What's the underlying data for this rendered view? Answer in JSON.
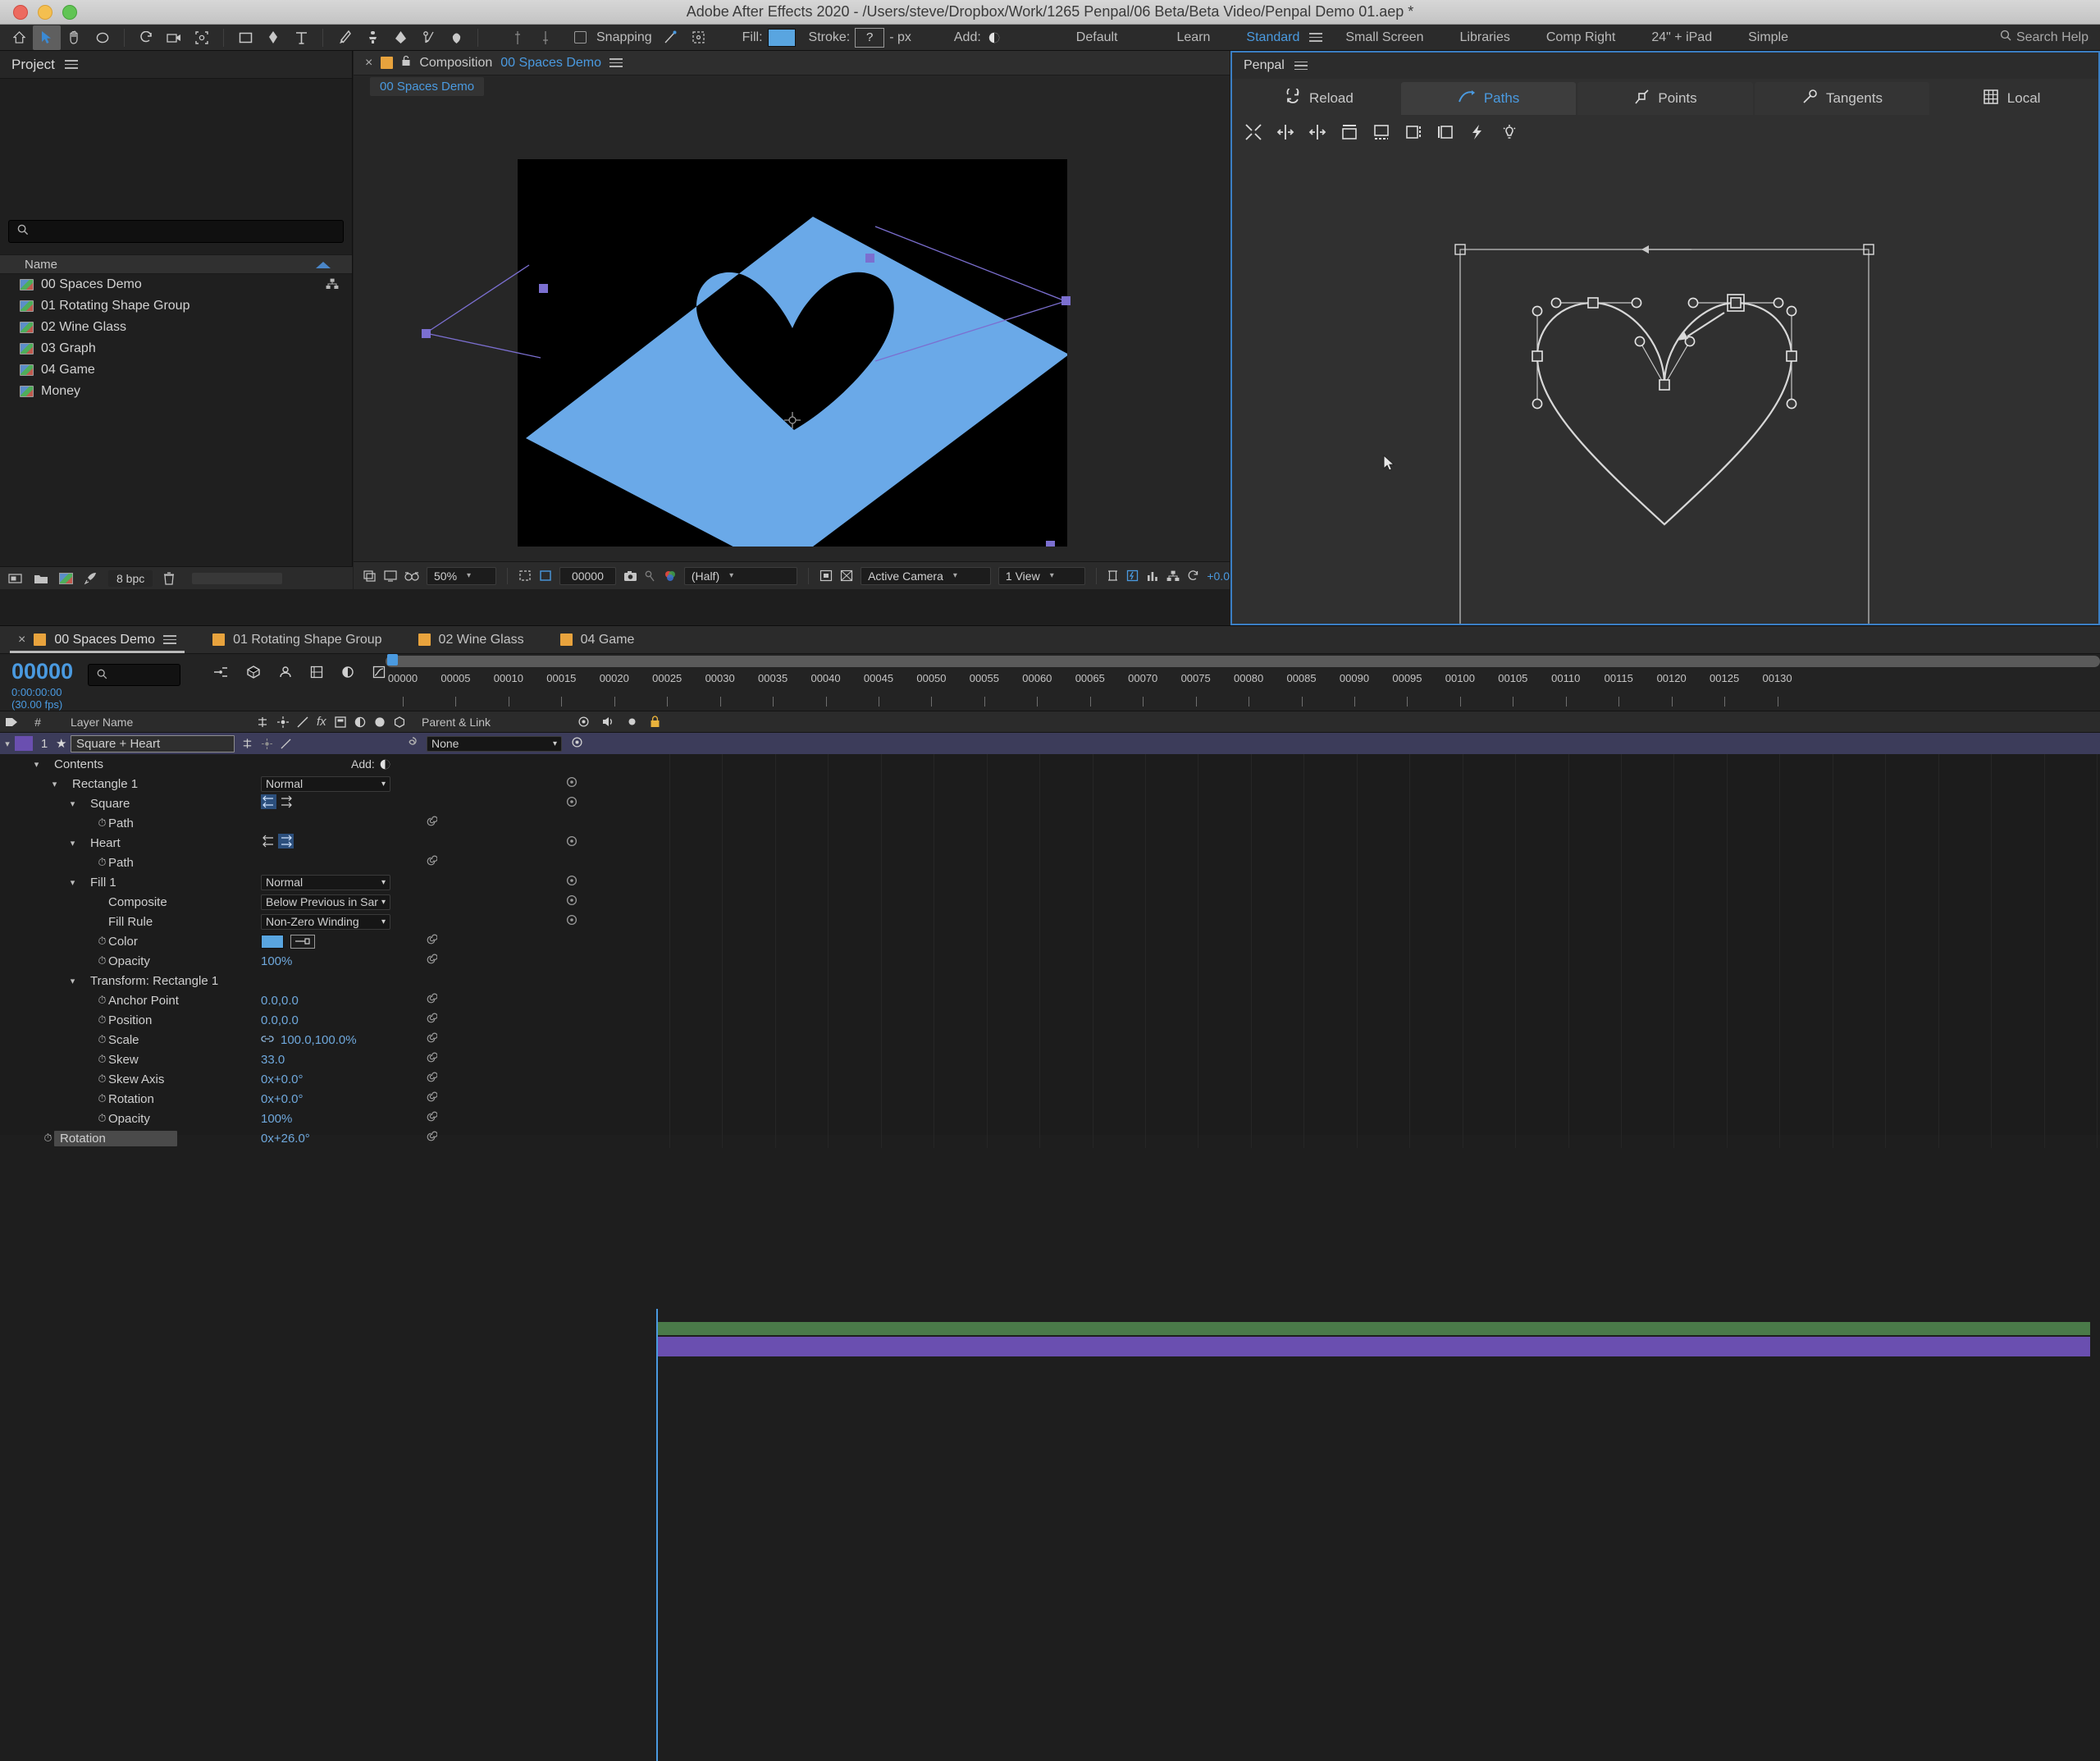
{
  "window": {
    "title": "Adobe After Effects 2020 - /Users/steve/Dropbox/Work/1265 Penpal/06 Beta/Beta Video/Penpal Demo 01.aep *"
  },
  "toolbar": {
    "snapping_label": "Snapping",
    "fill_label": "Fill:",
    "fill_color": "#59a5e0",
    "stroke_label": "Stroke:",
    "stroke_value": "?",
    "stroke_units": "- px",
    "add_label": "Add:",
    "default_label": "Default",
    "workspaces": [
      {
        "label": "Learn",
        "active": false
      },
      {
        "label": "Standard",
        "active": true
      },
      {
        "label": "Small Screen",
        "active": false
      },
      {
        "label": "Libraries",
        "active": false
      },
      {
        "label": "Comp Right",
        "active": false
      },
      {
        "label": "24\" + iPad",
        "active": false
      },
      {
        "label": "Simple",
        "active": false
      }
    ],
    "search_help": "Search Help"
  },
  "project": {
    "title": "Project",
    "search_placeholder": "",
    "column_header": "Name",
    "items": [
      {
        "name": "00 Spaces Demo"
      },
      {
        "name": "01 Rotating Shape Group"
      },
      {
        "name": "02 Wine Glass"
      },
      {
        "name": "03 Graph"
      },
      {
        "name": "04 Game"
      },
      {
        "name": "Money"
      }
    ],
    "footer": {
      "bpc": "8 bpc"
    }
  },
  "composition": {
    "tab_prefix": "Composition",
    "tab_name": "00 Spaces Demo",
    "sub_tab": "00 Spaces Demo",
    "bottom": {
      "zoom": "50%",
      "timecode": "00000",
      "resolution": "(Half)",
      "camera": "Active Camera",
      "views": "1 View",
      "exposure": "+0.0"
    }
  },
  "penpal": {
    "title": "Penpal",
    "tabs": [
      {
        "label": "Reload",
        "icon": "reload-icon",
        "active": false
      },
      {
        "label": "Paths",
        "icon": "path-icon",
        "active": true
      },
      {
        "label": "Points",
        "icon": "point-icon",
        "active": false
      },
      {
        "label": "Tangents",
        "icon": "tangent-icon",
        "active": false
      },
      {
        "label": "Local",
        "icon": "grid-icon",
        "active": false
      }
    ],
    "tool_icons": [
      "collapse-icon",
      "align-horizontal-icon",
      "distribute-horizontal-icon",
      "align-top-icon",
      "align-bottom-icon",
      "align-left-icon",
      "align-right-icon",
      "lightning-icon",
      "bulb-icon"
    ]
  },
  "timeline": {
    "tabs": [
      {
        "label": "00 Spaces Demo",
        "active": true
      },
      {
        "label": "01 Rotating Shape Group",
        "active": false
      },
      {
        "label": "02 Wine Glass",
        "active": false
      },
      {
        "label": "04 Game",
        "active": false
      }
    ],
    "current_time_frames": "00000",
    "current_time_code": "0:00:00:00 (30.00 fps)",
    "search_placeholder": "",
    "columns": {
      "num": "#",
      "layer_name": "Layer Name",
      "parent": "Parent & Link",
      "add": "Add:"
    },
    "ruler_ticks": [
      "00000",
      "00005",
      "00010",
      "00015",
      "00020",
      "00025",
      "00030",
      "00035",
      "00040",
      "00045",
      "00050",
      "00055",
      "00060",
      "00065",
      "00070",
      "00075",
      "00080",
      "00085",
      "00090",
      "00095",
      "00100",
      "00105",
      "00110",
      "00115",
      "00120",
      "00125",
      "00130"
    ],
    "layer": {
      "index": "1",
      "name": "Square + Heart",
      "parent": "None"
    },
    "rows": [
      {
        "depth": 1,
        "twirl": "v",
        "label": "Contents",
        "value": "",
        "control": "add"
      },
      {
        "depth": 2,
        "twirl": "v",
        "label": "Rectangle 1",
        "value": "",
        "control": "dropdown",
        "dropdown": "Normal"
      },
      {
        "depth": 3,
        "twirl": "v",
        "label": "Square",
        "value": "",
        "control": "arrows-left"
      },
      {
        "depth": 4,
        "twirl": "",
        "label": "Path",
        "value": "",
        "control": "none",
        "stopwatch": true
      },
      {
        "depth": 3,
        "twirl": "v",
        "label": "Heart",
        "value": "",
        "control": "arrows-right"
      },
      {
        "depth": 4,
        "twirl": "",
        "label": "Path",
        "value": "",
        "control": "none",
        "stopwatch": true
      },
      {
        "depth": 3,
        "twirl": "v",
        "label": "Fill 1",
        "value": "",
        "control": "dropdown",
        "dropdown": "Normal"
      },
      {
        "depth": 4,
        "twirl": "",
        "label": "Composite",
        "value": "",
        "control": "dropdown",
        "dropdown": "Below Previous in Sar"
      },
      {
        "depth": 4,
        "twirl": "",
        "label": "Fill Rule",
        "value": "",
        "control": "dropdown",
        "dropdown": "Non-Zero Winding"
      },
      {
        "depth": 4,
        "twirl": "",
        "label": "Color",
        "value": "",
        "control": "color",
        "stopwatch": true
      },
      {
        "depth": 4,
        "twirl": "",
        "label": "Opacity",
        "value": "100%",
        "control": "value",
        "stopwatch": true
      },
      {
        "depth": 3,
        "twirl": "v",
        "label": "Transform: Rectangle 1",
        "value": "",
        "control": "none"
      },
      {
        "depth": 4,
        "twirl": "",
        "label": "Anchor Point",
        "value": "0.0,0.0",
        "control": "value",
        "stopwatch": true
      },
      {
        "depth": 4,
        "twirl": "",
        "label": "Position",
        "value": "0.0,0.0",
        "control": "value",
        "stopwatch": true
      },
      {
        "depth": 4,
        "twirl": "",
        "label": "Scale",
        "value": "100.0,100.0%",
        "control": "value-link",
        "stopwatch": true
      },
      {
        "depth": 4,
        "twirl": "",
        "label": "Skew",
        "value": "33.0",
        "control": "value",
        "stopwatch": true
      },
      {
        "depth": 4,
        "twirl": "",
        "label": "Skew Axis",
        "value": "0x+0.0°",
        "control": "value",
        "stopwatch": true
      },
      {
        "depth": 4,
        "twirl": "",
        "label": "Rotation",
        "value": "0x+0.0°",
        "control": "value",
        "stopwatch": true
      },
      {
        "depth": 4,
        "twirl": "",
        "label": "Opacity",
        "value": "100%",
        "control": "value",
        "stopwatch": true
      },
      {
        "depth": 1,
        "twirl": "",
        "label": "Rotation",
        "value": "0x+26.0°",
        "control": "value",
        "stopwatch": true,
        "selected": true
      }
    ]
  },
  "colors": {
    "accent_blue": "#4a9ae0",
    "fill_blue": "#59a5e0",
    "layer_bar": "#6a4fb0",
    "work_area_green": "#4a7a49"
  }
}
